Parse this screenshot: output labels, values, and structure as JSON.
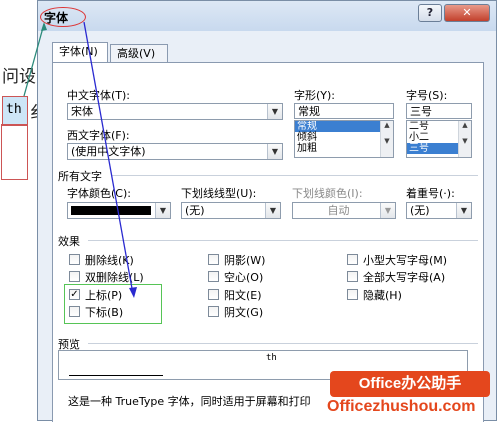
{
  "background_doc": {
    "line1": "问设",
    "line2_sel": "th",
    "line2_rest": "纟"
  },
  "dialog": {
    "title": "字体",
    "help_label": "?",
    "close_label": "✕",
    "tabs": [
      {
        "label": "字体(N)"
      },
      {
        "label": "高级(V)"
      }
    ]
  },
  "font": {
    "cn_label": "中文字体(T):",
    "cn_value": "宋体",
    "west_label": "西文字体(F):",
    "west_value": "(使用中文字体)",
    "style_label": "字形(Y):",
    "style_value": "常规",
    "style_list": [
      "常规",
      "倾斜",
      "加粗"
    ],
    "size_label": "字号(S):",
    "size_value": "三号",
    "size_list": [
      "二号",
      "小二",
      "三号"
    ]
  },
  "all_text": {
    "section_label": "所有文字",
    "color_label": "字体颜色(C):",
    "underline_label": "下划线线型(U):",
    "underline_value": "(无)",
    "underline_color_label": "下划线颜色(I):",
    "underline_color_value": "自动",
    "emphasis_label": "着重号(·):",
    "emphasis_value": "(无)"
  },
  "effects": {
    "section_label": "效果",
    "items": [
      {
        "label": "删除线(K)",
        "checked": false
      },
      {
        "label": "双删除线(L)",
        "checked": false
      },
      {
        "label": "上标(P)",
        "checked": true
      },
      {
        "label": "下标(B)",
        "checked": false
      },
      {
        "label": "阴影(W)",
        "checked": false
      },
      {
        "label": "空心(O)",
        "checked": false
      },
      {
        "label": "阳文(E)",
        "checked": false
      },
      {
        "label": "阴文(G)",
        "checked": false
      },
      {
        "label": "小型大写字母(M)",
        "checked": false
      },
      {
        "label": "全部大写字母(A)",
        "checked": false
      },
      {
        "label": "隐藏(H)",
        "checked": false
      }
    ]
  },
  "preview": {
    "section_label": "预览",
    "sample": "th",
    "note": "这是一种 TrueType 字体，同时适用于屏幕和打印"
  },
  "watermark": {
    "badge": "Office办公助手",
    "url": "Officezhushou.com"
  },
  "colors": {
    "accent": "#3b7fd1",
    "annotation_green": "#56c456",
    "annotation_red": "#dd3333",
    "arrow_blue": "#2a2ad0",
    "brand_orange": "#e4471d"
  }
}
